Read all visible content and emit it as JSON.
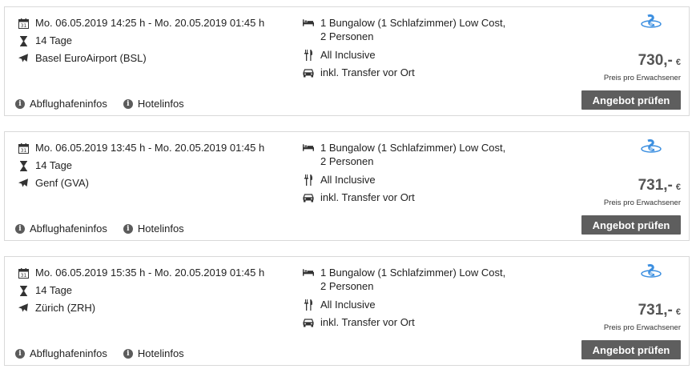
{
  "offers": [
    {
      "dates": "Mo. 06.05.2019 14:25 h - Mo. 20.05.2019 01:45 h",
      "duration": "14 Tage",
      "airport": "Basel EuroAirport (BSL)",
      "room": "1 Bungalow (1 Schlafzimmer) Low Cost, 2 Personen",
      "board": "All Inclusive",
      "transfer": "inkl. Transfer vor Ort",
      "airport_info": "Abflughafeninfos",
      "hotel_info": "Hotelinfos",
      "price": "730,-",
      "currency": "€",
      "price_note": "Preis pro Erwachsener",
      "button": "Angebot prüfen"
    },
    {
      "dates": "Mo. 06.05.2019 13:45 h - Mo. 20.05.2019 01:45 h",
      "duration": "14 Tage",
      "airport": "Genf (GVA)",
      "room": "1 Bungalow (1 Schlafzimmer) Low Cost, 2 Personen",
      "board": "All Inclusive",
      "transfer": "inkl. Transfer vor Ort",
      "airport_info": "Abflughafeninfos",
      "hotel_info": "Hotelinfos",
      "price": "731,-",
      "currency": "€",
      "price_note": "Preis pro Erwachsener",
      "button": "Angebot prüfen"
    },
    {
      "dates": "Mo. 06.05.2019 15:35 h - Mo. 20.05.2019 01:45 h",
      "duration": "14 Tage",
      "airport": "Zürich (ZRH)",
      "room": "1 Bungalow (1 Schlafzimmer) Low Cost, 2 Personen",
      "board": "All Inclusive",
      "transfer": "inkl. Transfer vor Ort",
      "airport_info": "Abflughafeninfos",
      "hotel_info": "Hotelinfos",
      "price": "731,-",
      "currency": "€",
      "price_note": "Preis pro Erwachsener",
      "button": "Angebot prüfen"
    }
  ],
  "icons": {
    "date": "calendar-icon",
    "duration": "hourglass-icon",
    "airport": "airplane-icon",
    "room": "bed-icon",
    "board": "cutlery-icon",
    "transfer": "car-icon",
    "info": "info-icon",
    "operator": "tour-operator-logo"
  },
  "colors": {
    "button_bg": "#5e5e5e",
    "price": "#555555",
    "border": "#d9d9d9",
    "logo": "#3c8fe0"
  }
}
